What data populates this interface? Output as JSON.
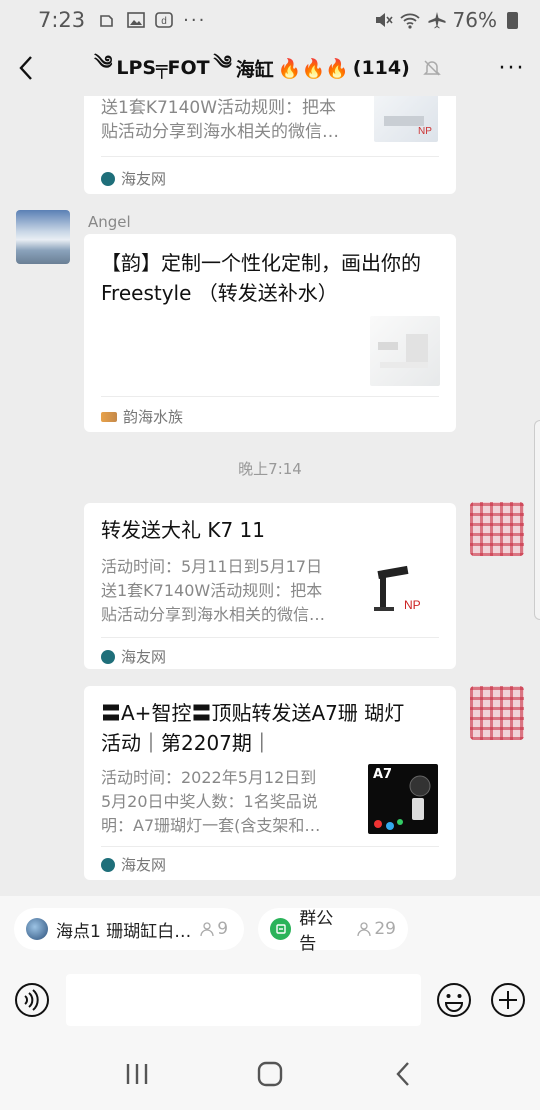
{
  "status_bar": {
    "time": "7:23",
    "battery": "76%"
  },
  "header": {
    "title_left_deco": "༄",
    "title_text": "LPS╤FOT",
    "title_right_deco": "༄",
    "title_main": "海缸",
    "fire": "🔥🔥🔥",
    "count": "(114)"
  },
  "messages": [
    {
      "title_partial": "送1套K7140W活动规则：把本",
      "desc_partial": "贴活动分享到海水相关的微信…",
      "source": "海友网"
    },
    {
      "sender": "Angel",
      "title": "【韵】定制一个性化定制，画出你的Freestyle （转发送补水）",
      "source": "韵海水族"
    },
    {
      "timestamp": "晚上7:14"
    },
    {
      "title": "转发送大礼 K7 11",
      "desc_line1": "活动时间：5月11日到5月17日",
      "desc_line2": "送1套K7140W活动规则：把本",
      "desc_line3": "贴活动分享到海水相关的微信…",
      "source": "海友网"
    },
    {
      "title_line1": "〓A+智控〓顶贴转发送A7珊 瑚灯",
      "title_line2": "活动｜第2207期｜",
      "desc_line1": "活动时间：2022年5月12日到",
      "desc_line2": "5月20日中奖人数：1名奖品说",
      "desc_line3": "明：A7珊瑚灯一套(含支架和…",
      "thumb_label": "A7",
      "source": "海友网"
    }
  ],
  "chips": [
    {
      "label": "海点1 珊瑚缸白…",
      "count": "9"
    },
    {
      "label": "群公告",
      "count": "29"
    }
  ],
  "input": {
    "placeholder": ""
  }
}
